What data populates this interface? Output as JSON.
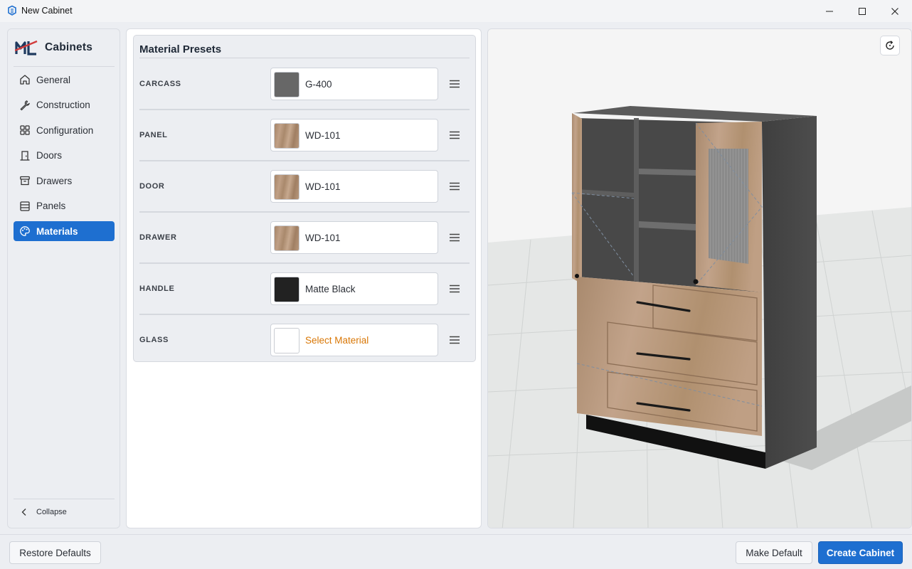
{
  "window": {
    "title": "New Cabinet"
  },
  "sidebar": {
    "brand": "Cabinets",
    "items": [
      {
        "label": "General",
        "icon": "home-icon"
      },
      {
        "label": "Construction",
        "icon": "wrench-icon"
      },
      {
        "label": "Configuration",
        "icon": "grid-icon"
      },
      {
        "label": "Doors",
        "icon": "door-icon"
      },
      {
        "label": "Drawers",
        "icon": "archive-icon"
      },
      {
        "label": "Panels",
        "icon": "panels-icon"
      },
      {
        "label": "Materials",
        "icon": "palette-icon",
        "active": true
      }
    ],
    "collapse_label": "Collapse"
  },
  "presets": {
    "title": "Material Presets",
    "rows": [
      {
        "label": "CARCASS",
        "value": "G-400",
        "swatch": "#676767"
      },
      {
        "label": "PANEL",
        "value": "WD-101",
        "swatch": "wood"
      },
      {
        "label": "DOOR",
        "value": "WD-101",
        "swatch": "wood"
      },
      {
        "label": "DRAWER",
        "value": "WD-101",
        "swatch": "wood"
      },
      {
        "label": "HANDLE",
        "value": "Matte Black",
        "swatch": "#222222"
      },
      {
        "label": "GLASS",
        "value": "Select Material",
        "swatch": "#ffffff",
        "placeholder": true
      }
    ]
  },
  "footer": {
    "restore_label": "Restore Defaults",
    "make_default_label": "Make Default",
    "create_label": "Create Cabinet"
  },
  "colors": {
    "accent": "#1e6fd0",
    "placeholder": "#d97706",
    "cabinet_wood": "#b8987c",
    "cabinet_carcass": "#4a4a4a"
  }
}
